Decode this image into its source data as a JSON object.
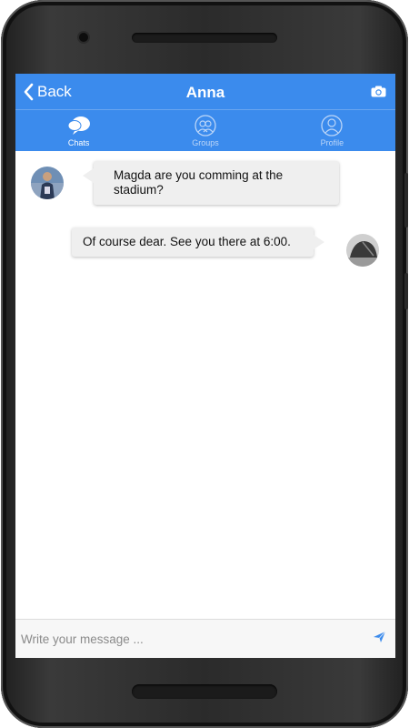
{
  "header": {
    "back_label": "Back",
    "title": "Anna",
    "camera_icon": "camera-icon",
    "back_icon": "chevron-left-icon"
  },
  "tabs": [
    {
      "label": "Chats",
      "icon": "chat-bubbles-icon",
      "active": true
    },
    {
      "label": "Groups",
      "icon": "group-icon",
      "active": false
    },
    {
      "label": "Profile",
      "icon": "profile-icon",
      "active": false
    }
  ],
  "messages": [
    {
      "side": "left",
      "text": "Magda are you comming at the stadium?"
    },
    {
      "side": "right",
      "text": "Of course dear. See you there at 6:00."
    }
  ],
  "composer": {
    "placeholder": "Write your message ...",
    "send_icon": "send-icon"
  },
  "colors": {
    "accent": "#3b8bed",
    "bubble": "#efefef"
  }
}
